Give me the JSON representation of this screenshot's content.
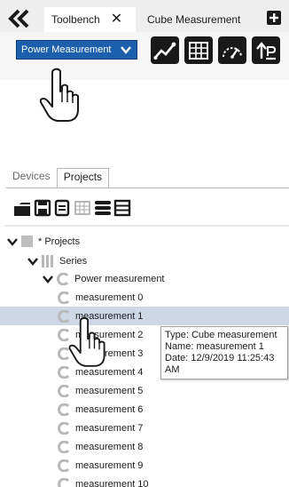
{
  "tabstrip": {
    "active_tab": "Toolbench",
    "inactive_tab": "Cube Measurement",
    "close_glyph": "✕"
  },
  "toolbench": {
    "dropdown_value": "Power Measurement",
    "accent_color": "#1b5fad",
    "tools": [
      "line-chart-icon",
      "table-icon",
      "gauge-icon",
      "export-icon"
    ]
  },
  "project_panel": {
    "tabs": [
      "Devices",
      "Projects"
    ],
    "active_tab": "Projects",
    "toolbar": [
      "open-folder-icon",
      "save-icon",
      "notes-icon",
      "grid-icon",
      "database-icon",
      "list-icon"
    ]
  },
  "tree": {
    "root": "* Projects",
    "series": "Series",
    "group": "Power measurement",
    "items": [
      "measurement 0",
      "measurement 1",
      "measurement 2",
      "measurement 3",
      "measurement 4",
      "measurement 5",
      "measurement 6",
      "measurement 7",
      "measurement 8",
      "measurement 9",
      "measurement 10"
    ],
    "selected_item": "measurement 1"
  },
  "tooltip": {
    "type": "Type: Cube measurement",
    "name": "Name: measurement 1",
    "date": "Date: 12/9/2019 11:25:43 AM"
  }
}
